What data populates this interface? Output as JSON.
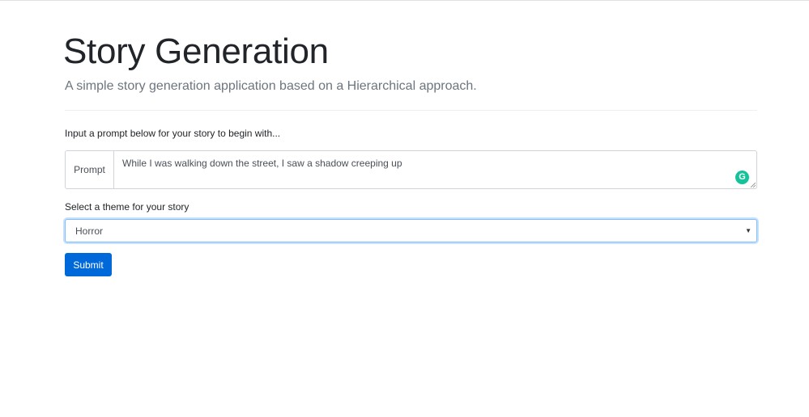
{
  "header": {
    "title": "Story Generation",
    "subtitle": "A simple story generation application based on a Hierarchical approach."
  },
  "form": {
    "prompt_instruction": "Input a prompt below for your story to begin with...",
    "prompt_addon_label": "Prompt",
    "prompt_value": "While I was walking down the street, I saw a shadow creeping up",
    "theme_label": "Select a theme for your story",
    "theme_selected": "Horror",
    "submit_label": "Submit"
  },
  "colors": {
    "primary_button": "#0069d9",
    "focus_border": "#80bdff",
    "grammarly_badge": "#15c39a"
  },
  "icons": {
    "grammarly": "grammarly-icon",
    "select_caret": "caret-down-icon",
    "resize": "resize-handle-icon"
  }
}
